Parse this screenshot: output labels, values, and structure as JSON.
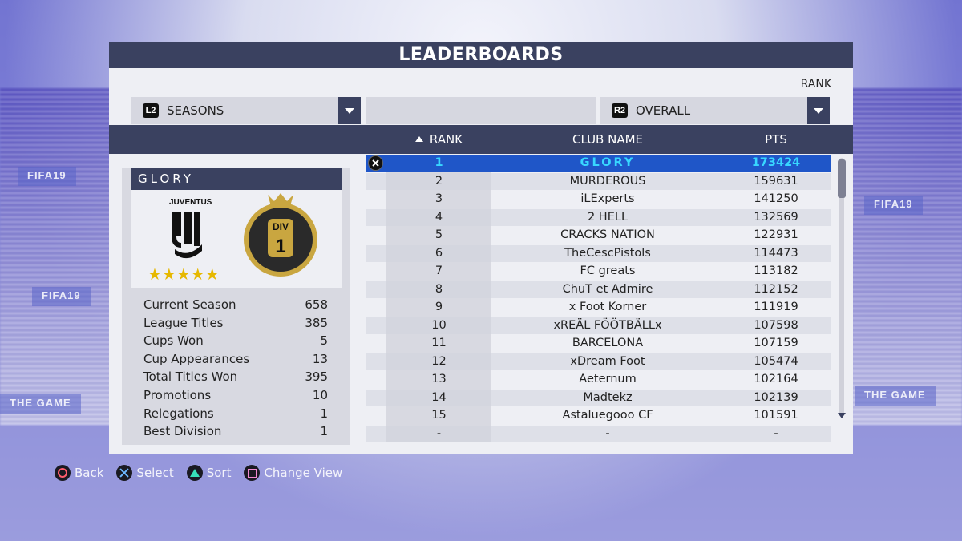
{
  "screen": {
    "title": "LEADERBOARDS",
    "rank_caption": "RANK"
  },
  "filters": {
    "left": {
      "button": "L2",
      "label": "SEASONS"
    },
    "middle": {
      "label": ""
    },
    "right": {
      "button": "R2",
      "label": "OVERALL"
    }
  },
  "columns": {
    "rank": "RANK",
    "club": "CLUB NAME",
    "pts": "PTS"
  },
  "club": {
    "name": "GLORY",
    "crest_text": "JUVENTUS",
    "stars": "★★★★★",
    "division_label": "DIV",
    "division_number": "1",
    "stats": [
      {
        "label": "Current Season",
        "value": "658"
      },
      {
        "label": "League Titles",
        "value": "385"
      },
      {
        "label": "Cups Won",
        "value": "5"
      },
      {
        "label": "Cup Appearances",
        "value": "13"
      },
      {
        "label": "Total Titles Won",
        "value": "395"
      },
      {
        "label": "Promotions",
        "value": "10"
      },
      {
        "label": "Relegations",
        "value": "1"
      },
      {
        "label": "Best Division",
        "value": "1"
      }
    ]
  },
  "rows": [
    {
      "rank": "1",
      "club": "GLORY",
      "pts": "173424"
    },
    {
      "rank": "2",
      "club": "MURDEROUS",
      "pts": "159631"
    },
    {
      "rank": "3",
      "club": "iLExperts",
      "pts": "141250"
    },
    {
      "rank": "4",
      "club": "2 HELL",
      "pts": "132569"
    },
    {
      "rank": "5",
      "club": "CRACKS NATION",
      "pts": "122931"
    },
    {
      "rank": "6",
      "club": "TheCescPistols",
      "pts": "114473"
    },
    {
      "rank": "7",
      "club": "FC greats",
      "pts": "113182"
    },
    {
      "rank": "8",
      "club": "ChuT et Admire",
      "pts": "112152"
    },
    {
      "rank": "9",
      "club": "x Foot Korner",
      "pts": "111919"
    },
    {
      "rank": "10",
      "club": "xREÄL FÖÖTBÄLLx",
      "pts": "107598"
    },
    {
      "rank": "11",
      "club": "BARCELONA",
      "pts": "107159"
    },
    {
      "rank": "12",
      "club": "xDream Foot",
      "pts": "105474"
    },
    {
      "rank": "13",
      "club": "Aeternum",
      "pts": "102164"
    },
    {
      "rank": "14",
      "club": "Madtekz",
      "pts": "102139"
    },
    {
      "rank": "15",
      "club": "Astaluegooo CF",
      "pts": "101591"
    },
    {
      "rank": "-",
      "club": "-",
      "pts": "-"
    }
  ],
  "selected_index": 0,
  "footer": [
    {
      "icon": "circle-button-icon",
      "label": "Back"
    },
    {
      "icon": "cross-button-icon",
      "label": "Select"
    },
    {
      "icon": "triangle-button-icon",
      "label": "Sort"
    },
    {
      "icon": "square-button-icon",
      "label": "Change View"
    }
  ],
  "background_banners": [
    "FIFA19",
    "FIFA19",
    "THE GAME",
    "THE GAME",
    "FIFA19"
  ],
  "colors": {
    "header": "#3a4160",
    "selected_row": "#1f56c8",
    "selected_text": "#38d7ff",
    "gold": "#c9a640"
  }
}
